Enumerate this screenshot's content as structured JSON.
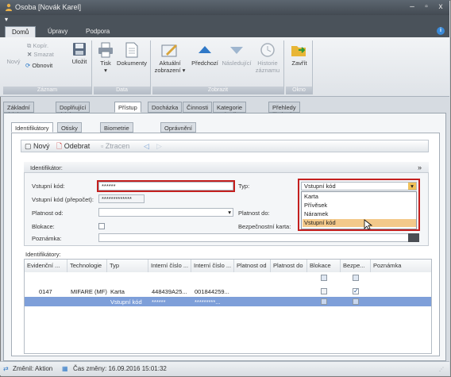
{
  "window": {
    "title": "Osoba [Novák Karel]",
    "minimize": "–",
    "maximize": "▫",
    "close": "x"
  },
  "ribbon_tabs": [
    {
      "label": "Domů"
    },
    {
      "label": "Úpravy"
    },
    {
      "label": "Podpora"
    }
  ],
  "ribbon": {
    "kopir": "Kopír.",
    "smazat": "Smazat",
    "novy": "Nový",
    "obnovit": "Obnovit",
    "ulozit": "Uložit",
    "tisk": "Tisk",
    "dokumenty": "Dokumenty",
    "aktualni_zobrazeni_1": "Aktuální",
    "aktualni_zobrazeni_2": "zobrazení",
    "predchozi": "Předchozí",
    "nasledujici": "Následující",
    "historie_1": "Historie",
    "historie_2": "záznamu",
    "zavrit": "Zavřít",
    "groups": {
      "zaznam": "Záznam",
      "data": "Data",
      "zobrazit": "Zobrazit",
      "okno": "Okno"
    }
  },
  "page_tabs": [
    {
      "label": "Základní údaje"
    },
    {
      "label": "Doplňující údaje"
    },
    {
      "label": "Přístup"
    },
    {
      "label": "Docházka"
    },
    {
      "label": "Činnosti"
    },
    {
      "label": "Kategorie strávníka"
    },
    {
      "label": "Přehledy školení"
    }
  ],
  "sub_tabs": [
    {
      "label": "Identifikátory"
    },
    {
      "label": "Otisky prstů"
    },
    {
      "label": "Biometrie obličeje"
    },
    {
      "label": "Oprávnění přístupu na snímače"
    }
  ],
  "toolbar": {
    "novy": "Nový",
    "odebrat": "Odebrat",
    "ztracen": "Ztracen"
  },
  "form": {
    "header": "Identifikátor:",
    "vstupni_kod_label": "Vstupní kód:",
    "vstupni_kod_value": "******",
    "prepocet_label": "Vstupní kód (přepočet):",
    "prepocet_value": "*************",
    "platnost_od_label": "Platnost od:",
    "blokace_label": "Blokace:",
    "poznamka_label": "Poznámka:",
    "typ_label": "Typ:",
    "typ_value": "Vstupní kód",
    "platnost_do_label": "Platnost do:",
    "bezpecnostni_karta_label": "Bezpečnostní karta:"
  },
  "typ_options": [
    "Karta",
    "Přívěsek",
    "Náramek",
    "Vstupní kód"
  ],
  "grid": {
    "caption": "Identifikátory:",
    "columns": [
      "Evidenční ...",
      "Technologie",
      "Typ",
      "Interní číslo ...",
      "Interní číslo ...",
      "Platnost od",
      "Platnost do",
      "Blokace",
      "Bezpe...",
      "Poznámka"
    ],
    "rows": [
      {
        "evidencni": "0147",
        "technologie": "MIFARE (MF)",
        "typ": "Karta",
        "interni1": "448439A25...",
        "interni2": "001844259...",
        "blokace": false,
        "bezpecnostni": true
      },
      {
        "evidencni": "",
        "technologie": "",
        "typ": "Vstupní kód",
        "interni1": "******",
        "interni2": "*********...",
        "blokace": false,
        "bezpecnostni": false
      }
    ]
  },
  "status": {
    "zmenil": "Změnil: Aktion",
    "cas_zmeny": "Čas změny: 16.09.2016 15:01:32"
  },
  "colors": {
    "highlight_red": "#c4201f",
    "selected_row": "#7e9fd9",
    "dropdown_selected": "#f3c98a"
  }
}
